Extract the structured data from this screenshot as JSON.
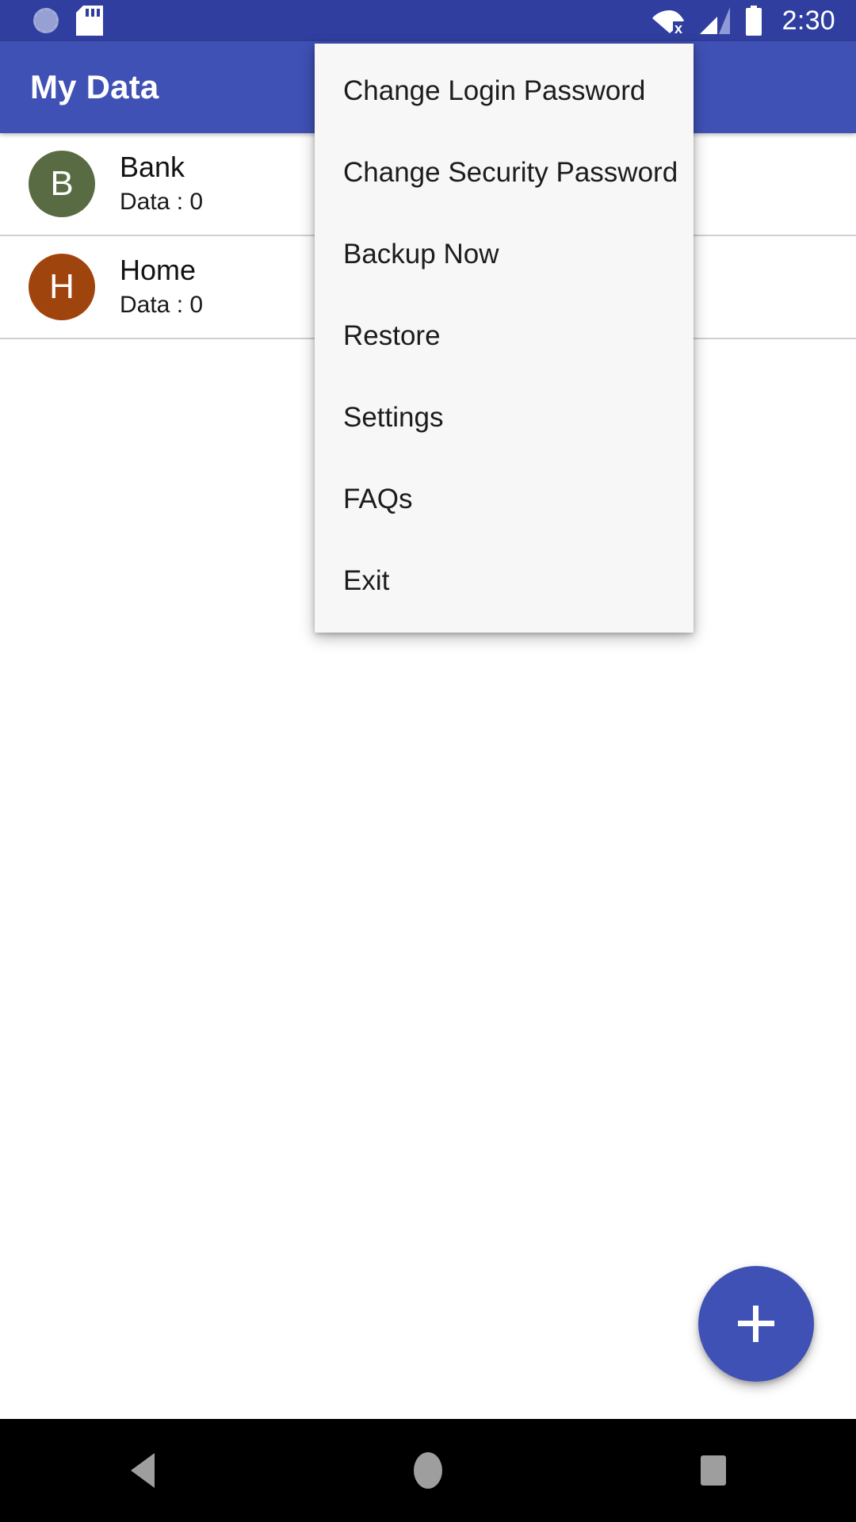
{
  "status_bar": {
    "time": "2:30",
    "background_color": "#303f9f",
    "icons_left": [
      "sync-icon",
      "sd-card-icon"
    ],
    "icons_right": [
      "wifi-off-icon",
      "cellular-signal-icon",
      "battery-full-icon"
    ]
  },
  "app_bar": {
    "title": "My Data",
    "background_color": "#3f51b5",
    "text_color": "#ffffff"
  },
  "list": {
    "rows": [
      {
        "initial": "B",
        "title": "Bank",
        "subtitle": "Data : 0",
        "avatar_color": "#586b42"
      },
      {
        "initial": "H",
        "title": "Home",
        "subtitle": "Data : 0",
        "avatar_color": "#a0440e"
      }
    ]
  },
  "overflow_menu": {
    "background_color": "#f7f7f7",
    "items": [
      {
        "label": "Change Login Password"
      },
      {
        "label": "Change Security Password"
      },
      {
        "label": "Backup Now"
      },
      {
        "label": "Restore"
      },
      {
        "label": "Settings"
      },
      {
        "label": "FAQs"
      },
      {
        "label": "Exit"
      }
    ]
  },
  "fab": {
    "icon": "plus-icon",
    "color": "#3f51b5"
  },
  "nav_bar": {
    "background_color": "#000000",
    "buttons": [
      "back-icon",
      "home-icon",
      "recents-icon"
    ]
  }
}
